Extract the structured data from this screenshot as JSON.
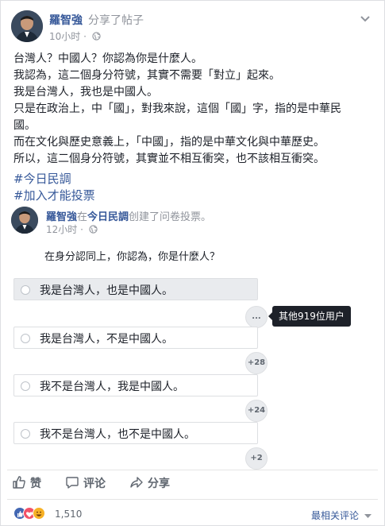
{
  "post": {
    "author": "羅智強",
    "shared_text": "分享了帖子",
    "time": "10小时",
    "body_lines": [
      "台灣人？中國人？你認為你是什麼人。",
      "我認為，這二個身分符號，其實不需要「對立」起來。",
      "我是台灣人，我也是中國人。",
      "只是在政治上，中「國」，對我來說，這個「國」字，指的是中華民",
      "國。",
      "而在文化與歷史意義上，「中國」，指的是中華文化與中華歷史。",
      "所以，這二個身分符號，其實並不相互衝突，也不該相互衝突。"
    ],
    "hashtags": [
      "#今日民調",
      "#加入才能投票"
    ]
  },
  "shared_post": {
    "author": "羅智強",
    "in_text": "在",
    "group": "今日民調",
    "action_text": "创建了问卷投票。",
    "time": "12小时"
  },
  "poll": {
    "question": "在身分認同上，你認為，你是什麼人？",
    "options": [
      {
        "label": "我是台灣人，也是中國人。",
        "count": "..."
      },
      {
        "label": "我是台灣人，不是中國人。",
        "count": "+28"
      },
      {
        "label": "我不是台灣人，我是中國人。",
        "count": "+24"
      },
      {
        "label": "我不是台灣人，也不是中國人。",
        "count": "+2"
      }
    ],
    "tooltip": "其他919位用户"
  },
  "actions": {
    "like": "赞",
    "comment": "评论",
    "share": "分享"
  },
  "footer": {
    "reaction_count": "1,510",
    "sort_label": "最相关评论"
  },
  "colors": {
    "link": "#365899",
    "muted": "#90949c",
    "like_blue": "#4267b2",
    "love_red": "#f25268",
    "haha_yellow": "#f7b125"
  }
}
